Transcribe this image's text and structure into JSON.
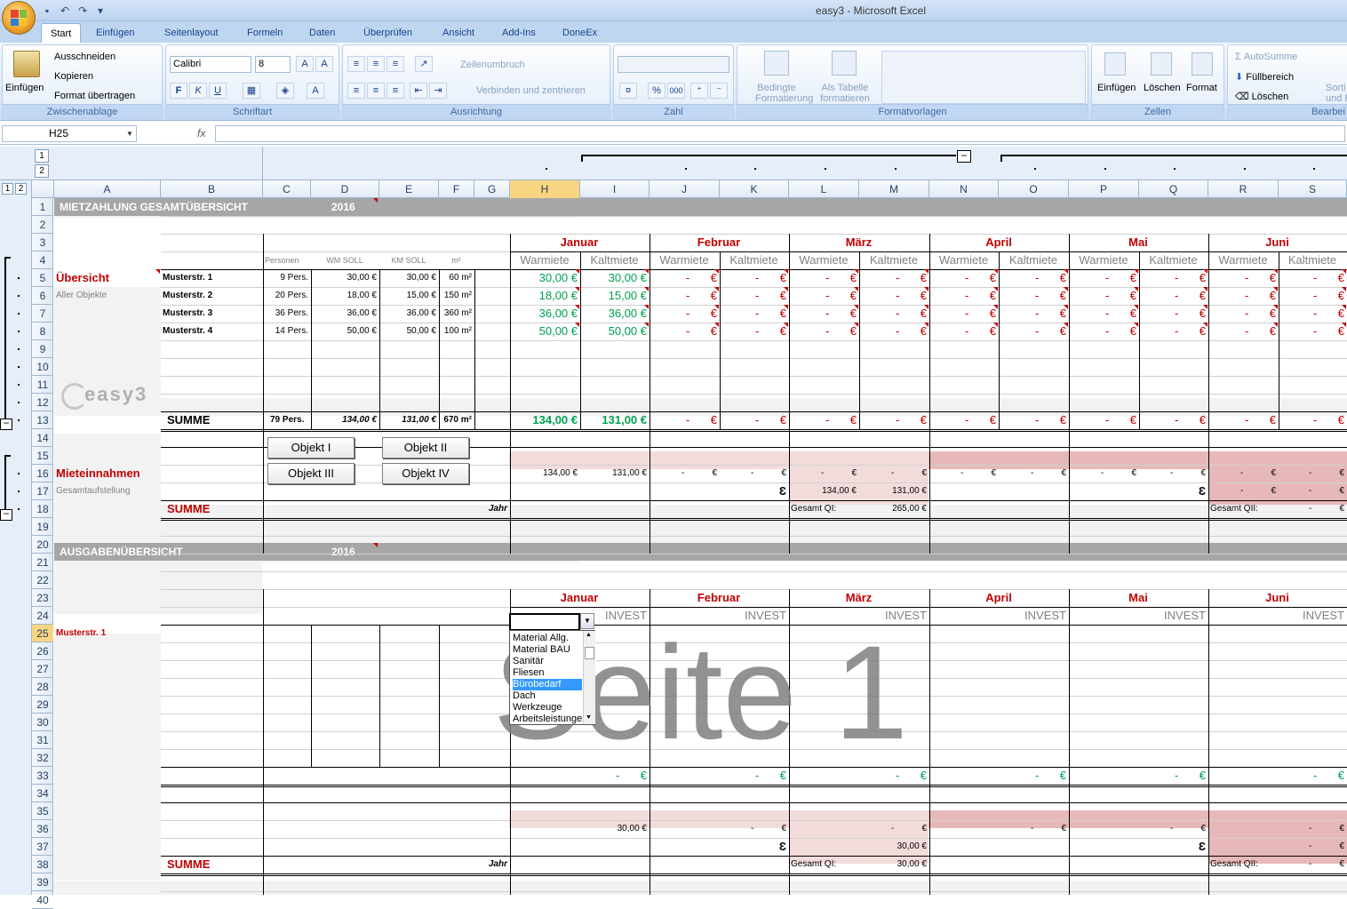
{
  "window": {
    "title": "easy3 - Microsoft Excel"
  },
  "tabs": [
    "Start",
    "Einfügen",
    "Seitenlayout",
    "Formeln",
    "Daten",
    "Überprüfen",
    "Ansicht",
    "Add-Ins",
    "DoneEx"
  ],
  "ribbon": {
    "clipboard": {
      "label": "Zwischenablage",
      "paste": "Einfügen",
      "cut": "Ausschneiden",
      "copy": "Kopieren",
      "format_painter": "Format übertragen"
    },
    "font": {
      "label": "Schriftart",
      "family": "Calibri",
      "size": "8",
      "bold": "F",
      "italic": "K",
      "underline": "U"
    },
    "alignment": {
      "label": "Ausrichtung",
      "wrap": "Zeilenumbruch",
      "merge": "Verbinden und zentrieren"
    },
    "number": {
      "label": "Zahl",
      "percent": "%",
      "thousands": "000"
    },
    "styles": {
      "label": "Formatvorlagen",
      "conditional": "Bedingte Formatierung",
      "as_table": "Als Tabelle formatieren"
    },
    "cells": {
      "label": "Zellen",
      "insert": "Einfügen",
      "delete": "Löschen",
      "format": "Format"
    },
    "editing": {
      "label": "Bearbei",
      "autosum": "AutoSumme",
      "fill": "Füllbereich",
      "clear": "Löschen",
      "sort": "Sorti und F"
    }
  },
  "formula": {
    "namebox": "H25",
    "fx": "fx"
  },
  "outline": {
    "level1": "1",
    "level2": "2"
  },
  "columns": [
    "A",
    "B",
    "C",
    "D",
    "E",
    "F",
    "G",
    "H",
    "I",
    "J",
    "K",
    "L",
    "M",
    "N",
    "O",
    "P",
    "Q",
    "R",
    "S"
  ],
  "rows": [
    "1",
    "2",
    "3",
    "4",
    "5",
    "6",
    "7",
    "8",
    "9",
    "10",
    "11",
    "12",
    "13",
    "14",
    "15",
    "16",
    "17",
    "18",
    "19",
    "20",
    "21",
    "22",
    "23",
    "24",
    "25",
    "26",
    "27",
    "28",
    "29",
    "30",
    "31",
    "32",
    "33",
    "34",
    "35",
    "36",
    "37",
    "38",
    "39",
    "40"
  ],
  "sheet": {
    "title1": "MIETZAHLUNG GESAMTÜBERSICHT",
    "year1": "2016",
    "months": [
      "Januar",
      "Februar",
      "März",
      "April",
      "Mai",
      "Juni"
    ],
    "warm": "Warmiete",
    "kalt": "Kaltmiete",
    "hdr_personen": "Personen",
    "hdr_wm": "WM SOLL",
    "hdr_km": "KM SOLL",
    "hdr_m2": "m²",
    "uebersicht": "Übersicht",
    "aller": "Aller Objekte",
    "props": [
      {
        "name": "Musterstr. 1",
        "pers": "9 Pers.",
        "wm": "30,00 €",
        "km": "30,00 €",
        "m2": "60 m²",
        "h": "30,00 €",
        "i": "30,00 €"
      },
      {
        "name": "Musterstr. 2",
        "pers": "20 Pers.",
        "wm": "18,00 €",
        "km": "15,00 €",
        "m2": "150 m²",
        "h": "18,00 €",
        "i": "15,00 €"
      },
      {
        "name": "Musterstr. 3",
        "pers": "36 Pers.",
        "wm": "36,00 €",
        "km": "36,00 €",
        "m2": "360 m²",
        "h": "36,00 €",
        "i": "36,00 €"
      },
      {
        "name": "Musterstr. 4",
        "pers": "14 Pers.",
        "wm": "50,00 €",
        "km": "50,00 €",
        "m2": "100 m²",
        "h": "50,00 €",
        "i": "50,00 €"
      }
    ],
    "dash": "-",
    "euro": "€",
    "logo": "easy3",
    "summe": "SUMME",
    "sum_pers": "79 Pers.",
    "sum_wm": "134,00 €",
    "sum_km": "131,00 €",
    "sum_m2": "670 m²",
    "sum_h": "134,00 €",
    "sum_i": "131,00 €",
    "mieteinnahmen": "Mieteinnahmen",
    "gesamtauf": "Gesamtaufstellung",
    "obj1": "Objekt I",
    "obj2": "Objekt II",
    "obj3": "Objekt III",
    "obj4": "Objekt IV",
    "r16_h": "134,00 €",
    "r16_i": "131,00 €",
    "r17_l": "134,00 €",
    "r17_m": "131,00 €",
    "sigma": "Ɛ",
    "jahr": "Jahr",
    "gesamt_qi": "Gesamt QI:",
    "gesamt_qi_val1": "265,00 €",
    "gesamt_qii": "Gesamt QII:",
    "title2": "AUSGABENÜBERSICHT",
    "year2": "2016",
    "invest": "INVEST",
    "muster1": "Musterstr. 1",
    "r36_i": "30,00 €",
    "r37_m": "30,00 €",
    "gesamt_qi_val2": "30,00 €"
  },
  "watermark": "Seite 1",
  "dropdown": [
    "Material Allg.",
    "Material BAU",
    "Sanitär",
    "Fliesen",
    "Bürobedarf",
    "Dach",
    "Werkzeuge",
    "Arbeitsleistunge"
  ],
  "dropdown_selected": "Bürobedarf"
}
